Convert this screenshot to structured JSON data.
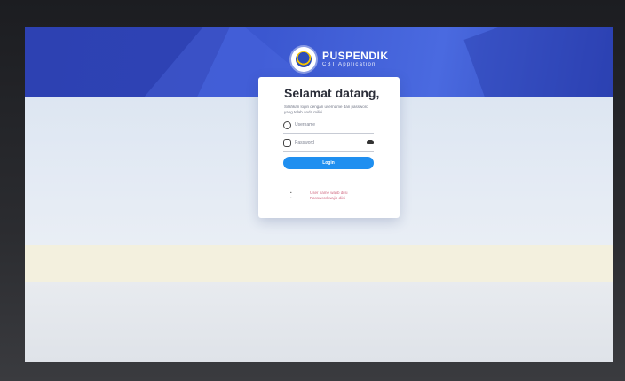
{
  "brand": {
    "title": "PUSPENDIK",
    "subtitle": "CBT Application"
  },
  "login": {
    "title": "Selamat datang,",
    "description": "Silahkan login dengan username dan password yang telah anda miliki.",
    "username_placeholder": "Username",
    "password_placeholder": "Password",
    "login_label": "Login"
  },
  "errors": {
    "bullet": "•",
    "items": [
      "User name wajib diisi",
      "Password wajib diisi"
    ]
  },
  "icons": {
    "user": "user-icon",
    "lock": "lock-icon",
    "eye": "eye-icon",
    "logo": "tut-wuri-handayani-logo"
  },
  "colors": {
    "banner": "#3b57d0",
    "button": "#1f8ff0",
    "error": "#d06a82"
  }
}
